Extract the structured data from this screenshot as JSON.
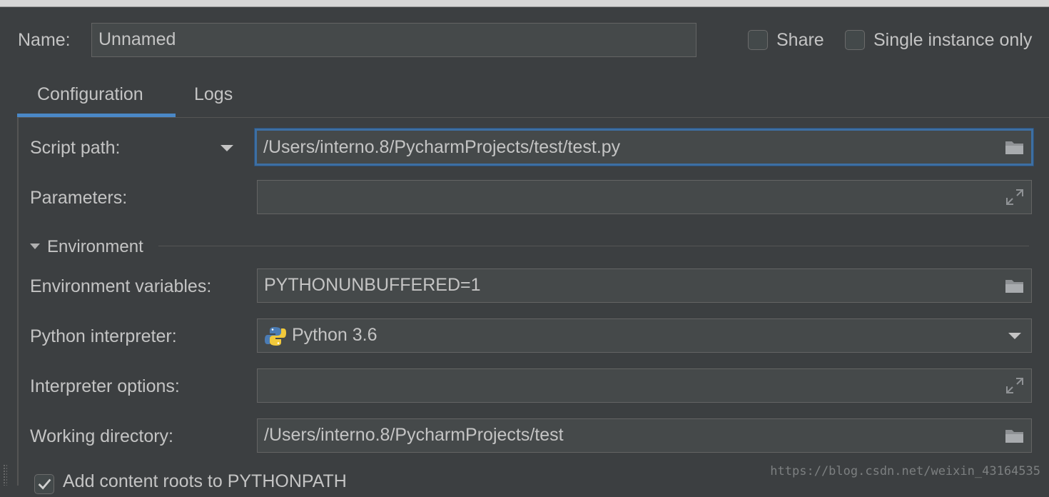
{
  "name_row": {
    "label": "Name:",
    "value": "Unnamed",
    "share_label": "Share",
    "share_checked": false,
    "single_instance_label": "Single instance only",
    "single_instance_checked": false
  },
  "tabs": [
    {
      "label": "Configuration",
      "active": true
    },
    {
      "label": "Logs",
      "active": false
    }
  ],
  "configuration": {
    "script_path": {
      "label": "Script path:",
      "value": "/Users/interno.8/PycharmProjects/test/test.py"
    },
    "parameters": {
      "label": "Parameters:",
      "value": ""
    },
    "environment": {
      "header": "Environment",
      "env_vars": {
        "label": "Environment variables:",
        "value": "PYTHONUNBUFFERED=1"
      },
      "interpreter": {
        "label": "Python interpreter:",
        "value": "Python 3.6"
      },
      "interpreter_options": {
        "label": "Interpreter options:",
        "value": ""
      },
      "working_dir": {
        "label": "Working directory:",
        "value": "/Users/interno.8/PycharmProjects/test"
      }
    },
    "add_content_roots": {
      "label": "Add content roots to PYTHONPATH",
      "checked": true
    }
  },
  "watermark": "https://blog.csdn.net/weixin_43164535",
  "colors": {
    "background": "#3c3f41",
    "field_bg": "#45494a",
    "accent": "#4a88c7",
    "text": "#c4c4c4"
  },
  "icons": [
    "folder-icon",
    "expand-icon",
    "python-icon",
    "chevron-down-icon",
    "checkmark-icon"
  ]
}
